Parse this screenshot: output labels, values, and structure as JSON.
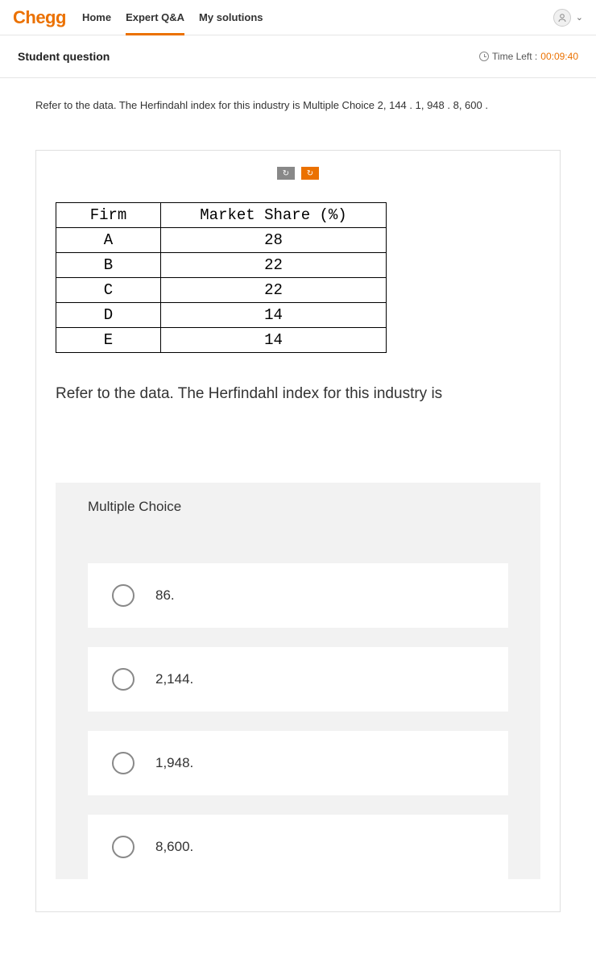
{
  "header": {
    "logo": "Chegg",
    "nav": {
      "home": "Home",
      "expert_qa": "Expert Q&A",
      "my_solutions": "My solutions"
    }
  },
  "question": {
    "title": "Student question",
    "time_label": "Time Left : ",
    "time_value": "00:09:40",
    "text": "Refer to the data. The Herfindahl index for this industry is Multiple Choice 2, 144 .  1, 948 .  8, 600 ."
  },
  "table": {
    "headers": {
      "firm": "Firm",
      "share": "Market Share (%)"
    },
    "rows": [
      {
        "firm": "A",
        "share": "28"
      },
      {
        "firm": "B",
        "share": "22"
      },
      {
        "firm": "C",
        "share": "22"
      },
      {
        "firm": "D",
        "share": "14"
      },
      {
        "firm": "E",
        "share": "14"
      }
    ]
  },
  "image_question": "Refer to the data. The Herfindahl index for this industry is",
  "mc": {
    "header": "Multiple Choice",
    "options": [
      "86.",
      "2,144.",
      "1,948.",
      "8,600."
    ]
  }
}
